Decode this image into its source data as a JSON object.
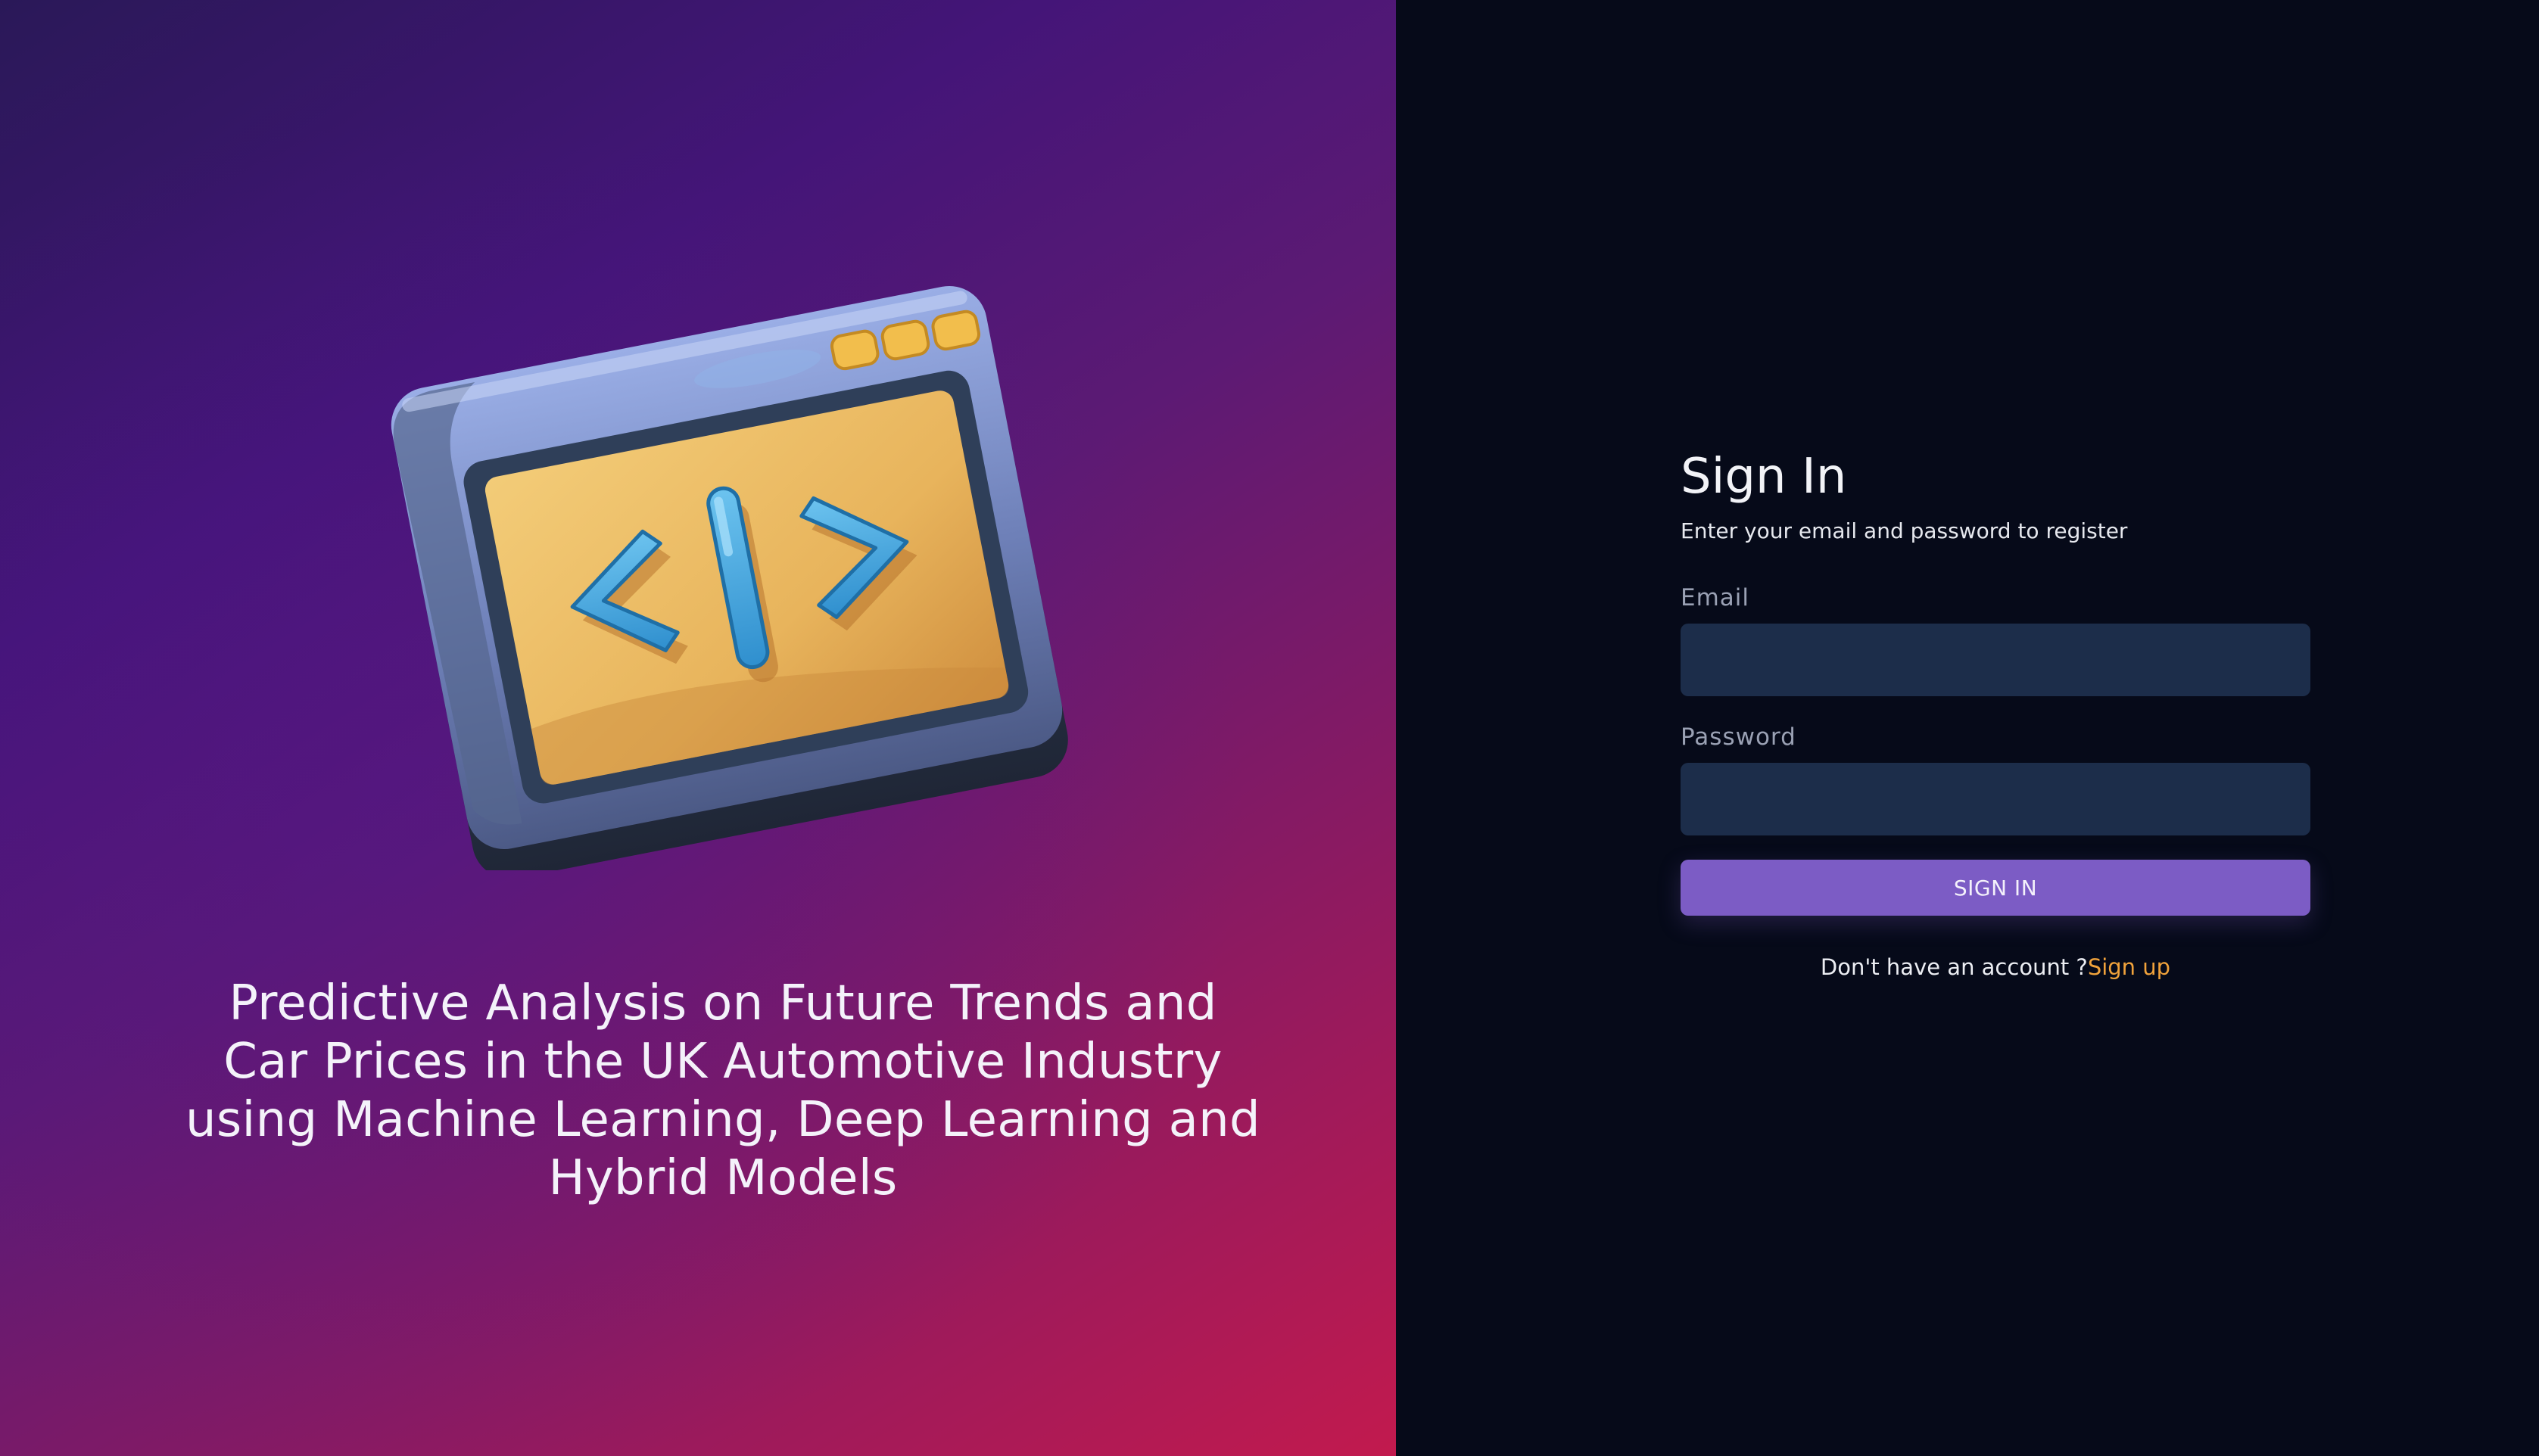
{
  "hero": {
    "title": "Predictive Analysis on Future Trends and Car Prices in the UK Automotive Industry using Machine Learning, Deep Learning and Hybrid Models",
    "illustration_icon": "code-window-icon"
  },
  "signin": {
    "title": "Sign In",
    "subtitle": "Enter your email and password to register",
    "email_label": "Email",
    "email_value": "",
    "email_placeholder": "",
    "password_label": "Password",
    "password_value": "",
    "password_placeholder": "",
    "button_label": "SIGN IN",
    "no_account_text": "Don't have an account ?",
    "signup_link": "Sign up"
  },
  "colors": {
    "right_background": "#060a19",
    "input_background": "#1c2d4a",
    "button_background": "#7c5cc5",
    "link_accent": "#f0a23b",
    "gradient_start": "#2a1858",
    "gradient_end": "#c21a4e"
  }
}
